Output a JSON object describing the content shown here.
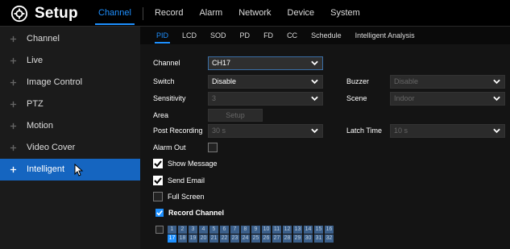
{
  "header": {
    "title": "Setup",
    "nav": [
      "Channel",
      "Record",
      "Alarm",
      "Network",
      "Device",
      "System"
    ],
    "active_index": 0
  },
  "sidebar": {
    "items": [
      {
        "label": "Channel"
      },
      {
        "label": "Live"
      },
      {
        "label": "Image Control"
      },
      {
        "label": "PTZ"
      },
      {
        "label": "Motion"
      },
      {
        "label": "Video Cover"
      },
      {
        "label": "Intelligent"
      }
    ],
    "active_index": 6
  },
  "subtabs": {
    "items": [
      "PID",
      "LCD",
      "SOD",
      "PD",
      "FD",
      "CC",
      "Schedule",
      "Intelligent Analysis"
    ],
    "active_index": 0
  },
  "form": {
    "channel": {
      "label": "Channel",
      "value": "CH17"
    },
    "switch": {
      "label": "Switch",
      "value": "Disable"
    },
    "buzzer": {
      "label": "Buzzer",
      "value": "Disable"
    },
    "sensitivity": {
      "label": "Sensitivity",
      "value": "3"
    },
    "scene": {
      "label": "Scene",
      "value": "Indoor"
    },
    "area": {
      "label": "Area",
      "button": "Setup"
    },
    "post_recording": {
      "label": "Post Recording",
      "value": "30 s"
    },
    "latch_time": {
      "label": "Latch Time",
      "value": "10 s"
    },
    "alarm_out": {
      "label": "Alarm Out"
    },
    "show_message": {
      "label": "Show Message"
    },
    "send_email": {
      "label": "Send Email"
    },
    "full_screen": {
      "label": "Full Screen"
    },
    "record_channel": {
      "label": "Record Channel"
    }
  },
  "channels": {
    "row1": [
      "1",
      "2",
      "3",
      "4",
      "5",
      "6",
      "7",
      "8",
      "9",
      "10",
      "11",
      "12",
      "13",
      "14",
      "15",
      "16"
    ],
    "row2": [
      "17",
      "18",
      "19",
      "20",
      "21",
      "22",
      "23",
      "24",
      "25",
      "26",
      "27",
      "28",
      "29",
      "30",
      "31",
      "32"
    ],
    "selected": "17"
  },
  "colors": {
    "accent": "#1e90ff",
    "sidebar_active": "#1565c0"
  }
}
